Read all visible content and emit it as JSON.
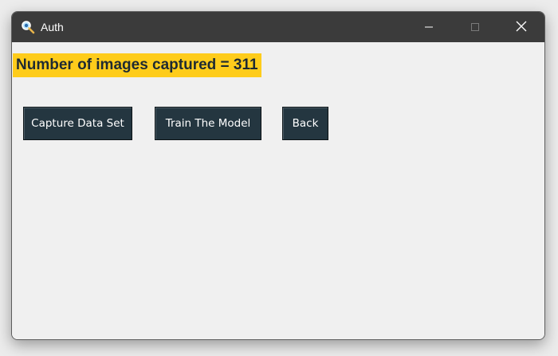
{
  "window": {
    "title": "Auth",
    "icon": "magnifier-icon"
  },
  "title_controls": {
    "minimize": "minimize-icon",
    "maximize": "maximize-icon",
    "close": "close-icon"
  },
  "status": {
    "text": "Number of images captured = 311"
  },
  "buttons": {
    "capture_label": "Capture Data Set",
    "train_label": "Train The Model",
    "back_label": "Back"
  },
  "colors": {
    "titlebar": "#3b3b3b",
    "window_bg": "#f0f0f0",
    "status_bg": "#fecc1b",
    "status_text": "#1e2a32",
    "button_bg": "#243640",
    "button_text": "#ffffff"
  }
}
